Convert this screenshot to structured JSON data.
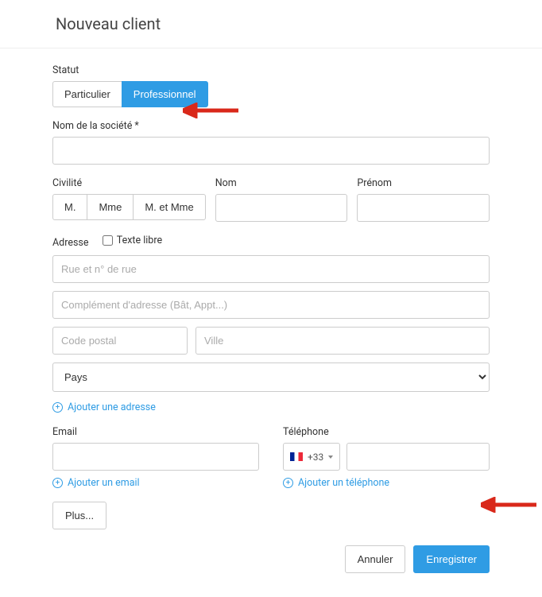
{
  "header": {
    "title": "Nouveau client"
  },
  "status": {
    "label": "Statut",
    "options": {
      "particulier": "Particulier",
      "professionnel": "Professionnel"
    }
  },
  "company": {
    "label": "Nom de la société *"
  },
  "civility": {
    "label": "Civilité",
    "options": {
      "m": "M.",
      "mme": "Mme",
      "mmme": "M. et Mme"
    }
  },
  "lastname": {
    "label": "Nom"
  },
  "firstname": {
    "label": "Prénom"
  },
  "address": {
    "label": "Adresse",
    "freetext": "Texte libre",
    "street_placeholder": "Rue et n° de rue",
    "complement_placeholder": "Complément d'adresse (Bât, Appt...)",
    "postal_placeholder": "Code postal",
    "city_placeholder": "Ville",
    "country_placeholder": "Pays",
    "add": "Ajouter une adresse"
  },
  "email": {
    "label": "Email",
    "add": "Ajouter un email"
  },
  "phone": {
    "label": "Téléphone",
    "prefix": "+33",
    "add": "Ajouter un téléphone"
  },
  "more": {
    "label": "Plus..."
  },
  "footer": {
    "cancel": "Annuler",
    "save": "Enregistrer"
  }
}
